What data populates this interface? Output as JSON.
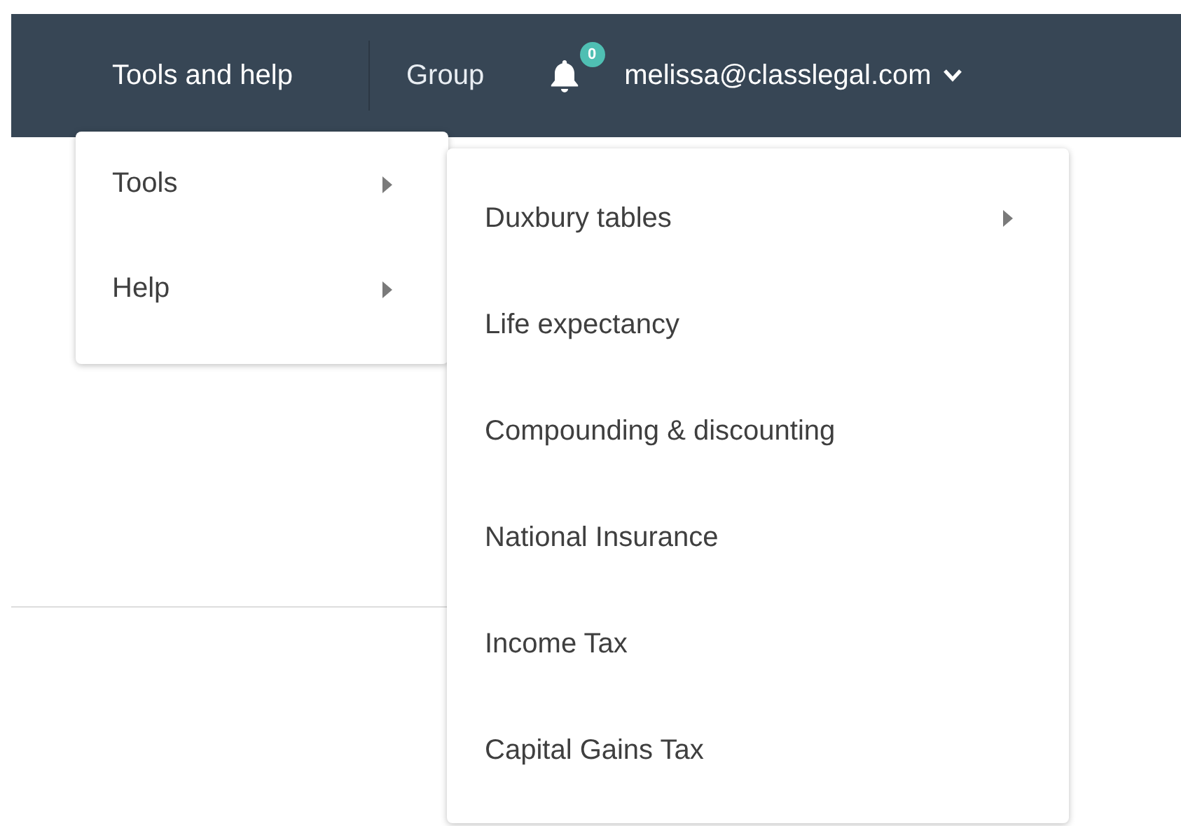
{
  "header": {
    "nav": [
      {
        "label": "Tools and help",
        "selected": true
      },
      {
        "label": "Group",
        "selected": false
      }
    ],
    "notifications": {
      "count": "0"
    },
    "account": {
      "email": "melissa@classlegal.com"
    }
  },
  "menu": {
    "items": [
      {
        "label": "Tools",
        "has_submenu": true
      },
      {
        "label": "Help",
        "has_submenu": true
      }
    ]
  },
  "submenu": {
    "items": [
      {
        "label": "Duxbury tables",
        "has_submenu": true
      },
      {
        "label": "Life expectancy",
        "has_submenu": false
      },
      {
        "label": "Compounding & discounting",
        "has_submenu": false
      },
      {
        "label": "National Insurance",
        "has_submenu": false
      },
      {
        "label": "Income Tax",
        "has_submenu": false
      },
      {
        "label": "Capital Gains Tax",
        "has_submenu": false
      }
    ]
  }
}
